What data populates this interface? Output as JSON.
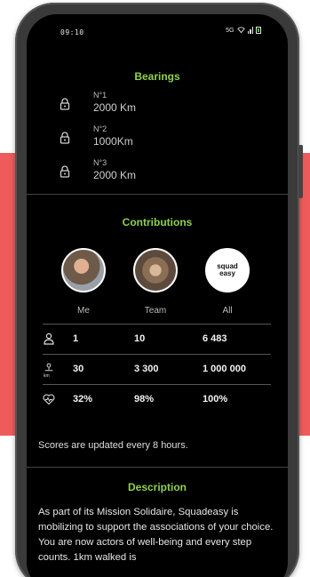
{
  "status": {
    "time": "09:10",
    "network": "5G"
  },
  "bearings": {
    "title": "Bearings",
    "items": [
      {
        "num": "N°1",
        "value": "2000 Km"
      },
      {
        "num": "N°2",
        "value": "1000Km"
      },
      {
        "num": "N°3",
        "value": "2000 Km"
      }
    ]
  },
  "contributions": {
    "title": "Contributions",
    "avatars": [
      {
        "label": "Me"
      },
      {
        "label": "Team"
      },
      {
        "label": "All",
        "logo_line1": "squad",
        "logo_line2": "easy"
      }
    ],
    "rows": [
      {
        "icon": "person-icon",
        "values": [
          "1",
          "10",
          "6 483"
        ]
      },
      {
        "icon": "distance-icon",
        "unit": "km",
        "values": [
          "30",
          "3 300",
          "1 000 000"
        ]
      },
      {
        "icon": "heart-rate-icon",
        "values": [
          "32%",
          "98%",
          "100%"
        ]
      }
    ],
    "note": "Scores are updated every 8 hours."
  },
  "description": {
    "title": "Description",
    "text": "As part of its Mission Solidaire, Squadeasy is mobilizing to support the associations of your choice. You are now actors of well-being and every step counts. 1km walked is"
  },
  "colors": {
    "accent": "#8fd14f",
    "background_band": "#ef5b5b",
    "screen": "#000000"
  }
}
